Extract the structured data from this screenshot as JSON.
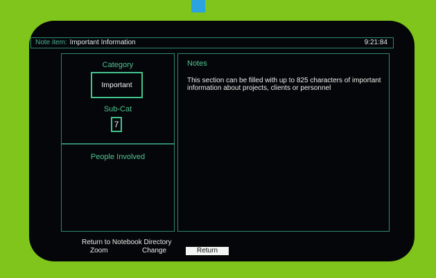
{
  "window": {
    "note_item_label": "Note item:",
    "note_item_value": "Important Information",
    "time": "9:21:84"
  },
  "category": {
    "title": "Category",
    "value": "Important",
    "subcat_title": "Sub-Cat",
    "subcat_value": "7"
  },
  "people": {
    "title": "People Involved"
  },
  "notes": {
    "title": "Notes",
    "text": "This section can be filled with up to 825 characters of important information about projects, clients or personnel"
  },
  "footer": {
    "line": "Return to Notebook Directory",
    "menu": [
      "Zoom",
      "Change",
      "Return"
    ],
    "selected": "Return"
  },
  "colors": {
    "background": "#7fc51c",
    "bezel": "#05060a",
    "accent_green": "#43c58e",
    "accent_blue": "#2aa3e0"
  }
}
